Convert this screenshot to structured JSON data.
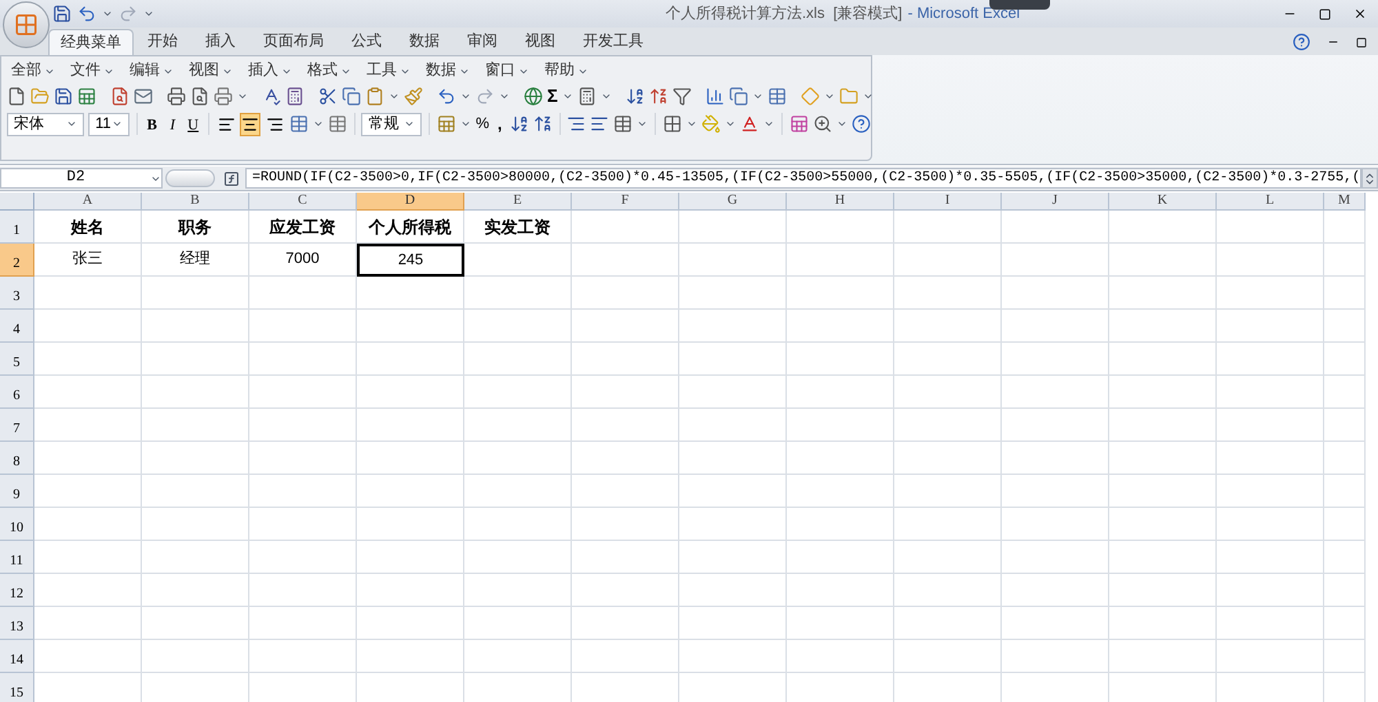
{
  "title": {
    "document": "个人所得税计算方法.xls  [兼容模式]",
    "app": "- Microsoft Excel"
  },
  "ribbon_tabs": [
    {
      "label": "经典菜单",
      "selected": true
    },
    {
      "label": "开始",
      "selected": false
    },
    {
      "label": "插入",
      "selected": false
    },
    {
      "label": "页面布局",
      "selected": false
    },
    {
      "label": "公式",
      "selected": false
    },
    {
      "label": "数据",
      "selected": false
    },
    {
      "label": "审阅",
      "selected": false
    },
    {
      "label": "视图",
      "selected": false
    },
    {
      "label": "开发工具",
      "selected": false
    }
  ],
  "classic_menu": [
    "全部",
    "文件",
    "编辑",
    "视图",
    "插入",
    "格式",
    "工具",
    "数据",
    "窗口",
    "帮助"
  ],
  "toolbar": {
    "sum": "Σ",
    "font": "宋体",
    "size": "11",
    "styles": [
      "B",
      "I",
      "U"
    ],
    "align": [
      {
        "selected": false
      },
      {
        "selected": true
      },
      {
        "selected": false
      }
    ],
    "number_format": "常规",
    "percent": "%",
    "comma": ","
  },
  "name_box": "D2",
  "formula": "=ROUND(IF(C2-3500>0,IF(C2-3500>80000,(C2-3500)*0.45-13505,(IF(C2-3500>55000,(C2-3500)*0.35-5505,(IF(C2-3500>35000,(C2-3500)*0.3-2755,(",
  "columns": [
    {
      "label": "A",
      "selected": false
    },
    {
      "label": "B",
      "selected": false
    },
    {
      "label": "C",
      "selected": false
    },
    {
      "label": "D",
      "selected": true
    },
    {
      "label": "E",
      "selected": false
    },
    {
      "label": "F",
      "selected": false
    },
    {
      "label": "G",
      "selected": false
    },
    {
      "label": "H",
      "selected": false
    },
    {
      "label": "I",
      "selected": false
    },
    {
      "label": "J",
      "selected": false
    },
    {
      "label": "K",
      "selected": false
    },
    {
      "label": "L",
      "selected": false
    },
    {
      "label": "M",
      "selected": false
    }
  ],
  "rows": [
    {
      "label": "1",
      "selected": false,
      "kind": "header",
      "cells": [
        "姓名",
        "职务",
        "应发工资",
        "个人所得税",
        "实发工资"
      ]
    },
    {
      "label": "2",
      "selected": true,
      "kind": "data",
      "cells": [
        "张三",
        "经理",
        "7000",
        "245"
      ]
    },
    {
      "label": "3",
      "selected": false,
      "kind": "data"
    },
    {
      "label": "4",
      "selected": false,
      "kind": "data"
    },
    {
      "label": "5",
      "selected": false,
      "kind": "data"
    },
    {
      "label": "6",
      "selected": false,
      "kind": "data"
    },
    {
      "label": "7",
      "selected": false,
      "kind": "data"
    },
    {
      "label": "8",
      "selected": false,
      "kind": "data"
    },
    {
      "label": "9",
      "selected": false,
      "kind": "data"
    },
    {
      "label": "10",
      "selected": false,
      "kind": "data"
    },
    {
      "label": "11",
      "selected": false,
      "kind": "data"
    },
    {
      "label": "12",
      "selected": false,
      "kind": "data"
    },
    {
      "label": "13",
      "selected": false,
      "kind": "data"
    },
    {
      "label": "14",
      "selected": false,
      "kind": "data"
    },
    {
      "label": "15",
      "selected": false,
      "kind": "data"
    }
  ]
}
